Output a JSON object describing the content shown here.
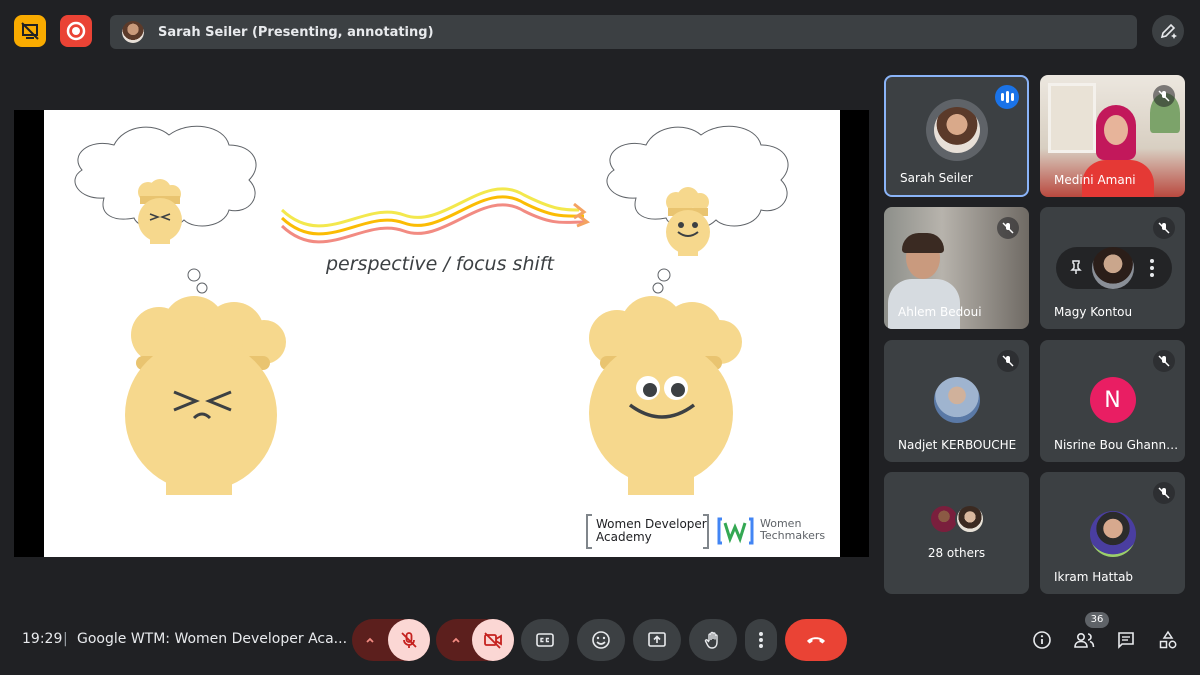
{
  "topbar": {
    "presenter_text": "Sarah Seiler (Presenting, annotating)",
    "colors": {
      "cast_button": "#f9ab00",
      "record_button": "#ea4335"
    }
  },
  "slide": {
    "caption": "perspective / focus shift",
    "logo_wda_line1": "Women Developer",
    "logo_wda_line2": "Academy",
    "logo_wtm_line1": "Women",
    "logo_wtm_line2": "Techmakers"
  },
  "participants": [
    {
      "name": "Sarah Seiler",
      "speaking": true
    },
    {
      "name": "Medini Amani",
      "muted": true
    },
    {
      "name": "Ahlem Bedoui",
      "muted": true
    },
    {
      "name": "Magy Kontou",
      "muted": true
    },
    {
      "name": "Nadjet KERBOUCHE",
      "muted": true
    },
    {
      "name": "Nisrine Bou Ghann…",
      "muted": true,
      "initial": "N"
    },
    {
      "name": "28 others"
    },
    {
      "name": "Ikram Hattab",
      "muted": true
    }
  ],
  "bottombar": {
    "time": "19:29",
    "separator": "|",
    "meeting_title": "Google WTM: Women Developer Aca...",
    "people_count": "36"
  }
}
